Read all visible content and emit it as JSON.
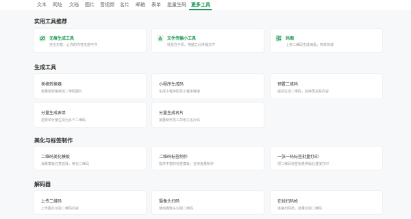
{
  "nav": {
    "tabs": [
      "文本",
      "网址",
      "文档",
      "图片",
      "音视频",
      "名片",
      "邮箱",
      "表单",
      "批量生码",
      "更多工具"
    ],
    "active_index": 9
  },
  "sections": {
    "practical": {
      "title": "实用工具推荐",
      "cards": [
        {
          "title": "无痕生成工具",
          "desc": "完全无痕，让你的内容无迹可寻",
          "icon": "eye-slash-icon"
        },
        {
          "title": "文件传输小工具",
          "desc": "轻松在手机、电脑之间传输文件",
          "icon": "recycle-icon"
        },
        {
          "title": "码图",
          "desc": "上传二维码生成海报，简单快速",
          "icon": "qr-grid-icon"
        }
      ]
    },
    "generate": {
      "title": "生成工具",
      "cards": [
        {
          "title": "表格转换器",
          "desc": "批量把表格转成二维码图片"
        },
        {
          "title": "小程序生成码",
          "desc": "生成小程序码及小程序链接"
        },
        {
          "title": "预置二维码",
          "desc": "提前生成二维码，后续再关联内容"
        },
        {
          "title": "分量生成表单",
          "desc": "把表单分量生成为多个二维码"
        },
        {
          "title": "分量生成名片",
          "desc": "批量制作员工的电子名片码"
        }
      ]
    },
    "beautify": {
      "title": "美化与标签制作",
      "cards": [
        {
          "title": "二维码美化模板",
          "desc": "海量模板任意选择，美化二维码"
        },
        {
          "title": "二维码标签制作",
          "desc": "提供丰富的标签模板，支持批量制作"
        },
        {
          "title": "一张一码标签批量打印",
          "desc": "把二维码标签批量排版后直接打印"
        }
      ]
    },
    "decoder": {
      "title": "解码器",
      "cards": [
        {
          "title": "上传二维码",
          "desc": "上传图片识别二维码内容"
        },
        {
          "title": "摄像头扫码",
          "desc": "使用摄像头识别二维码"
        },
        {
          "title": "在线扫码枪",
          "desc": "连接扫码枪，批量识别二维码"
        }
      ]
    }
  },
  "colors": {
    "accent": "#1a9a52",
    "accent_light": "#e8f6ee",
    "background": "#f7f8f9"
  }
}
